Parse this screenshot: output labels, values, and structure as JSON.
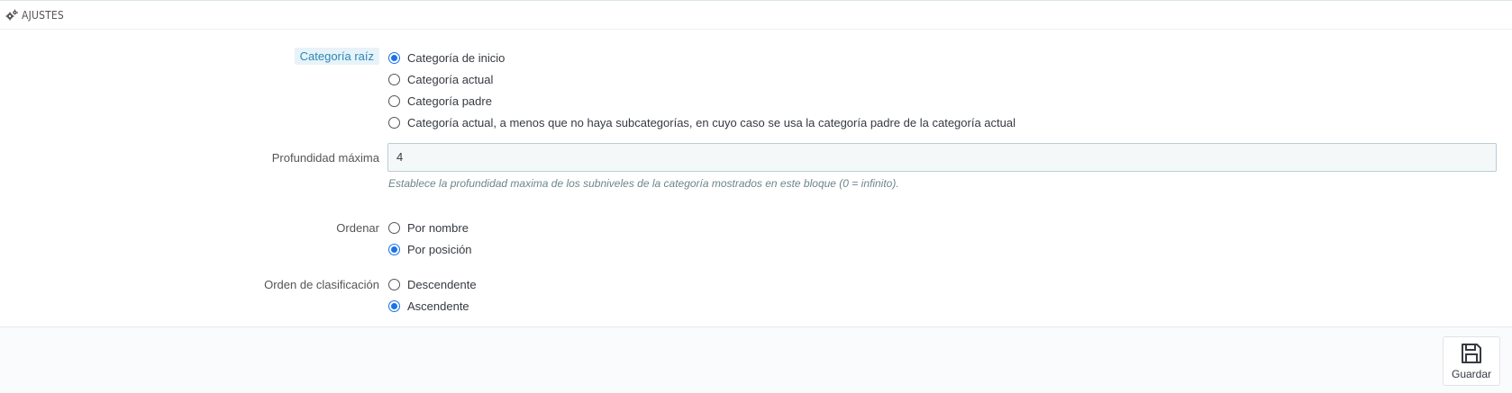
{
  "panel": {
    "heading": {
      "icon": "cogs-icon",
      "title": "AJUSTES"
    }
  },
  "form": {
    "root_category": {
      "label": "Categoría raíz",
      "options": [
        {
          "label": "Categoría de inicio",
          "checked": true
        },
        {
          "label": "Categoría actual",
          "checked": false
        },
        {
          "label": "Categoría padre",
          "checked": false
        },
        {
          "label": "Categoría actual, a menos que no haya subcategorías, en cuyo caso se usa la categoría padre de la categoría actual",
          "checked": false
        }
      ]
    },
    "max_depth": {
      "label": "Profundidad máxima",
      "value": "4",
      "help": "Establece la profundidad maxima de los subniveles de la categoría mostrados en este bloque (0 = infinito)."
    },
    "sort": {
      "label": "Ordenar",
      "options": [
        {
          "label": "Por nombre",
          "checked": false
        },
        {
          "label": "Por posición",
          "checked": true
        }
      ]
    },
    "sort_order": {
      "label": "Orden de clasificación",
      "options": [
        {
          "label": "Descendente",
          "checked": false
        },
        {
          "label": "Ascendente",
          "checked": true
        }
      ]
    }
  },
  "footer": {
    "save_label": "Guardar",
    "save_icon": "floppy-disk-icon"
  },
  "colors": {
    "accent": "#1a73e8",
    "label_highlight_bg": "#e7f3f9",
    "label_highlight_text": "#2c87b4"
  }
}
